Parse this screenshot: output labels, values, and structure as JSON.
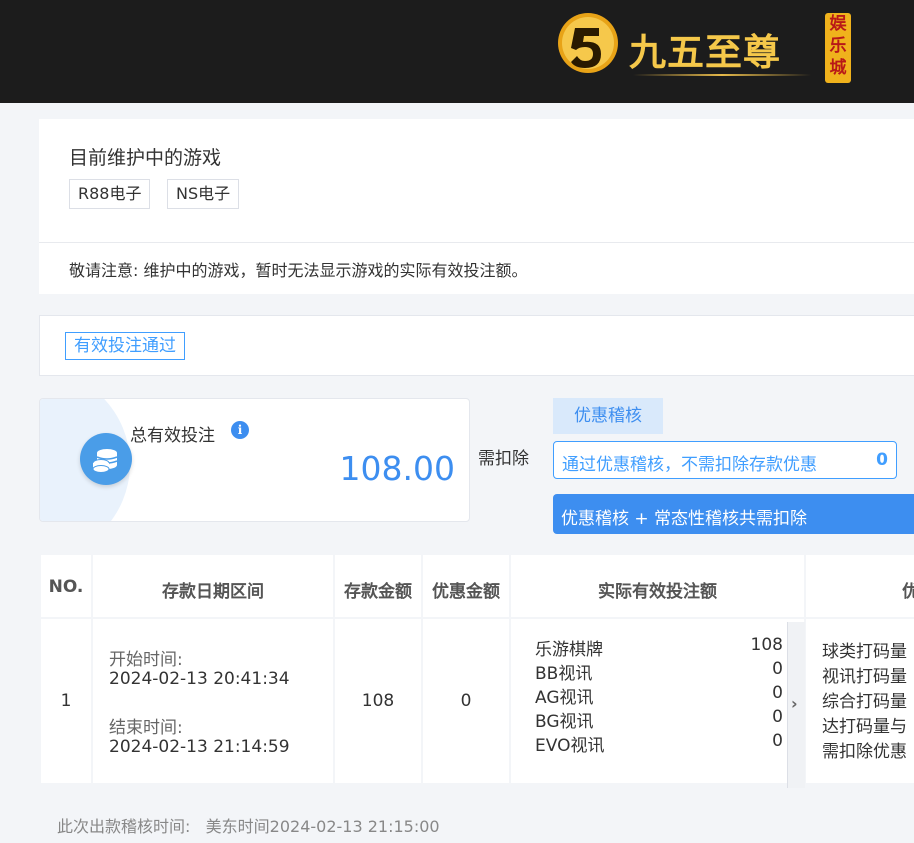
{
  "brand": {
    "name": "九五至尊",
    "badge": [
      "娱",
      "乐",
      "城"
    ],
    "accent": "#f5c84a"
  },
  "maintenance": {
    "title": "目前维护中的游戏",
    "games": [
      "R88电子",
      "NS电子"
    ],
    "note": "敬请注意: 维护中的游戏，暂时无法显示游戏的实际有效投注额。"
  },
  "status_tag": "有效投注通过",
  "total": {
    "label": "总有效投注",
    "value": "108.00"
  },
  "deduct": {
    "label": "需扣除",
    "promo_tab": "优惠稽核",
    "promo_text": "通过优惠稽核，不需扣除存款优惠",
    "promo_value": "0",
    "combo_text": "优惠稽核 + 常态性稽核共需扣除"
  },
  "table": {
    "headers": [
      "NO.",
      "存款日期区间",
      "存款金额",
      "优惠金额",
      "实际有效投注额",
      "优"
    ],
    "row": {
      "no": "1",
      "start_label": "开始时间:",
      "start_value": "2024-02-13 20:41:34",
      "end_label": "结束时间:",
      "end_value": "2024-02-13 21:14:59",
      "deposit": "108",
      "promo": "0",
      "bets": [
        {
          "name": "乐游棋牌",
          "value": "108"
        },
        {
          "name": "BB视讯",
          "value": "0"
        },
        {
          "name": "AG视讯",
          "value": "0"
        },
        {
          "name": "BG视讯",
          "value": "0"
        },
        {
          "name": "EVO视讯",
          "value": "0"
        }
      ],
      "stats": [
        "球类打码量",
        "视讯打码量",
        "综合打码量",
        "达打码量与",
        "需扣除优惠"
      ]
    }
  },
  "footer": {
    "label": "此次出款稽核时间:",
    "value": "美东时间2024-02-13 21:15:00"
  },
  "colors": {
    "primary": "#3d8ef0",
    "header_bg": "#1c1c1c",
    "page_bg": "#f3f5f8"
  }
}
